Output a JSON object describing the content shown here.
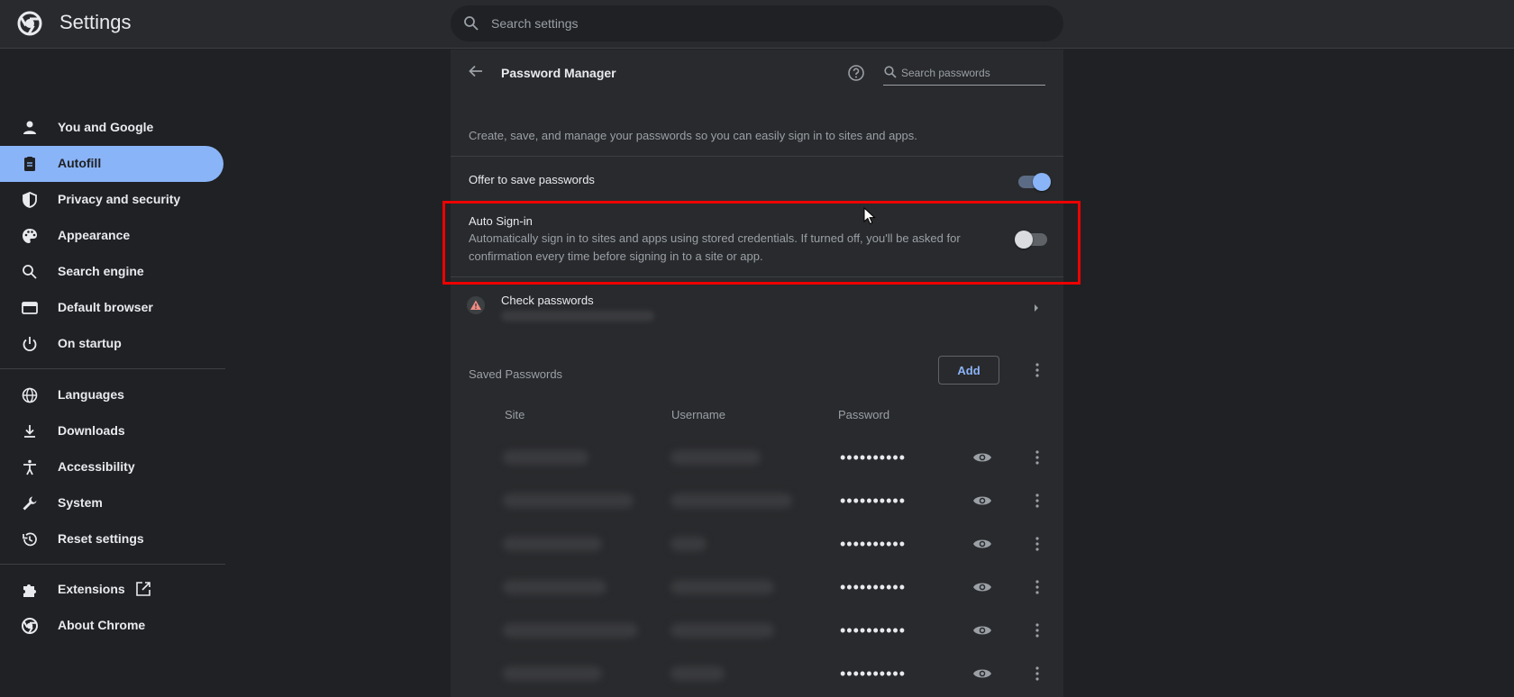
{
  "app": {
    "title": "Settings"
  },
  "search": {
    "placeholder": "Search settings"
  },
  "sidebar": {
    "items": [
      {
        "label": "You and Google",
        "icon": "person-icon"
      },
      {
        "label": "Autofill",
        "icon": "clipboard-icon",
        "active": true
      },
      {
        "label": "Privacy and security",
        "icon": "shield-icon"
      },
      {
        "label": "Appearance",
        "icon": "palette-icon"
      },
      {
        "label": "Search engine",
        "icon": "search-icon"
      },
      {
        "label": "Default browser",
        "icon": "browser-window-icon"
      },
      {
        "label": "On startup",
        "icon": "power-icon"
      },
      {
        "label": "Languages",
        "icon": "globe-icon"
      },
      {
        "label": "Downloads",
        "icon": "download-icon"
      },
      {
        "label": "Accessibility",
        "icon": "accessibility-icon"
      },
      {
        "label": "System",
        "icon": "wrench-icon"
      },
      {
        "label": "Reset settings",
        "icon": "history-icon"
      },
      {
        "label": "Extensions",
        "icon": "puzzle-icon"
      },
      {
        "label": "About Chrome",
        "icon": "chrome-icon"
      }
    ]
  },
  "password_manager": {
    "title": "Password Manager",
    "search_placeholder": "Search passwords",
    "description": "Create, save, and manage your passwords so you can easily sign in to sites and apps.",
    "offer_to_save": {
      "label": "Offer to save passwords",
      "enabled": true
    },
    "auto_signin": {
      "label": "Auto Sign-in",
      "description_line1": "Automatically sign in to sites and apps using stored credentials. If turned off, you'll be asked for",
      "description_line2": "confirmation every time before signing in to a site or app.",
      "enabled": false
    },
    "check_passwords": {
      "label": "Check passwords"
    },
    "saved_passwords": {
      "label": "Saved Passwords",
      "add_label": "Add",
      "columns": {
        "site": "Site",
        "username": "Username",
        "password": "Password"
      },
      "rows": [
        {
          "password_mask": "••••••••••"
        },
        {
          "password_mask": "••••••••••"
        },
        {
          "password_mask": "••••••••••"
        },
        {
          "password_mask": "••••••••••"
        },
        {
          "password_mask": "••••••••••"
        },
        {
          "password_mask": "••••••••••"
        }
      ]
    }
  },
  "colors": {
    "accent": "#8ab4f8",
    "background": "#202124",
    "surface": "#292a2d",
    "highlight": "#e00000"
  }
}
